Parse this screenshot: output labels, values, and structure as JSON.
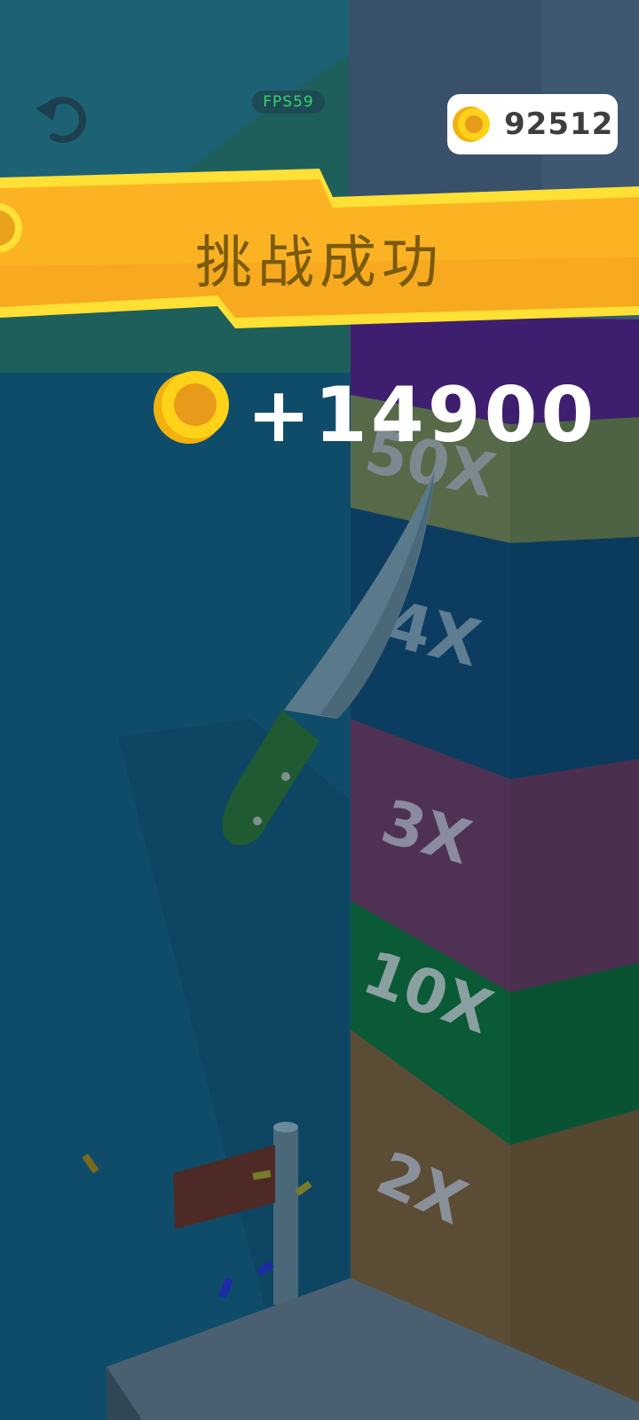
{
  "hud": {
    "fps_label": "FPS59",
    "coin_total": "92512",
    "coin_icon": "gold-coin-icon",
    "restart_icon": "restart-icon"
  },
  "result": {
    "title": "挑战成功",
    "reward": "+14900",
    "reward_icon": "gold-coin-icon"
  },
  "tower": {
    "blocks": [
      {
        "label": "50X",
        "color": "#546848"
      },
      {
        "label": "4X",
        "color": "#0c3f63"
      },
      {
        "label": "3X",
        "color": "#4d3152"
      },
      {
        "label": "10X",
        "color": "#0a5a36"
      },
      {
        "label": "2X",
        "color": "#5a4b34"
      }
    ],
    "top_color": "#3e1e6e"
  },
  "colors": {
    "sky": "#1c6274",
    "water": "#0f4c69",
    "banner": "#fbb324",
    "banner_edge": "#ffe035"
  }
}
